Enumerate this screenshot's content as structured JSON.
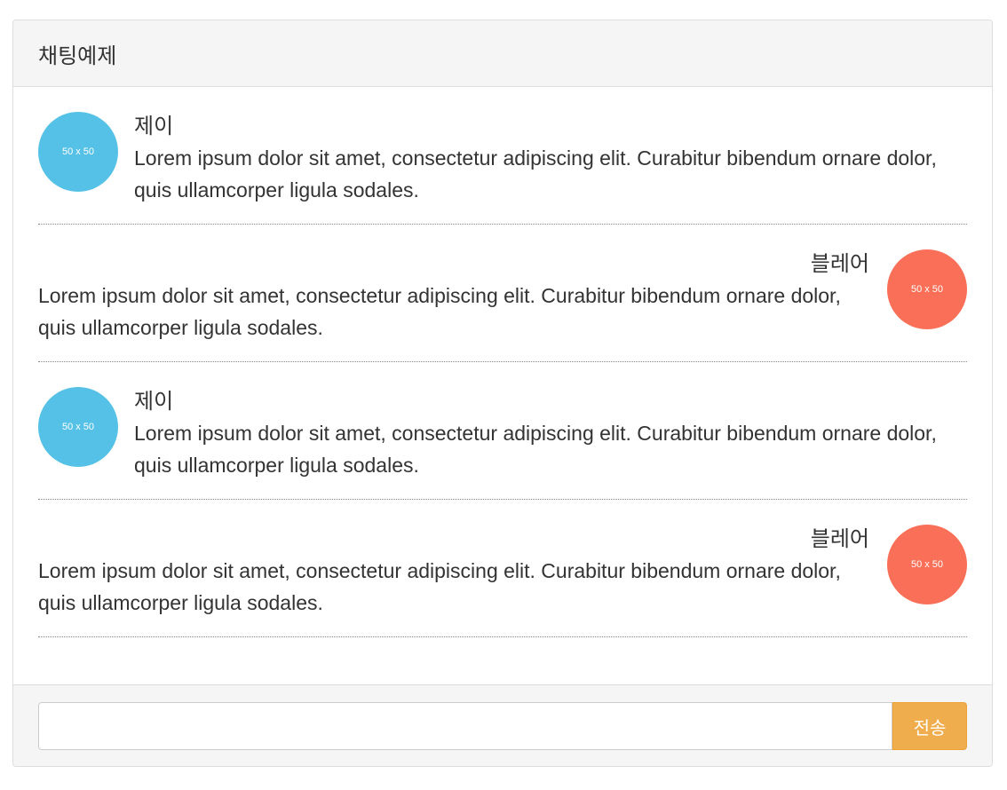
{
  "panel": {
    "title": "채팅예제"
  },
  "messages": [
    {
      "side": "left",
      "avatar_text": "50 x 50",
      "avatar_color": "#55c1e7",
      "name": "제이",
      "text": "Lorem ipsum dolor sit amet, consectetur adipiscing elit. Curabitur bibendum ornare dolor, quis ullamcorper ligula sodales."
    },
    {
      "side": "right",
      "avatar_text": "50 x 50",
      "avatar_color": "#fa6f57",
      "name": "블레어",
      "text": "Lorem ipsum dolor sit amet, consectetur adipiscing elit. Curabitur bibendum ornare dolor, quis ullamcorper ligula sodales."
    },
    {
      "side": "left",
      "avatar_text": "50 x 50",
      "avatar_color": "#55c1e7",
      "name": "제이",
      "text": "Lorem ipsum dolor sit amet, consectetur adipiscing elit. Curabitur bibendum ornare dolor, quis ullamcorper ligula sodales."
    },
    {
      "side": "right",
      "avatar_text": "50 x 50",
      "avatar_color": "#fa6f57",
      "name": "블레어",
      "text": "Lorem ipsum dolor sit amet, consectetur adipiscing elit. Curabitur bibendum ornare dolor, quis ullamcorper ligula sodales."
    }
  ],
  "footer": {
    "input_value": "",
    "input_placeholder": "",
    "send_label": "전송",
    "send_color": "#f0ad4e"
  }
}
